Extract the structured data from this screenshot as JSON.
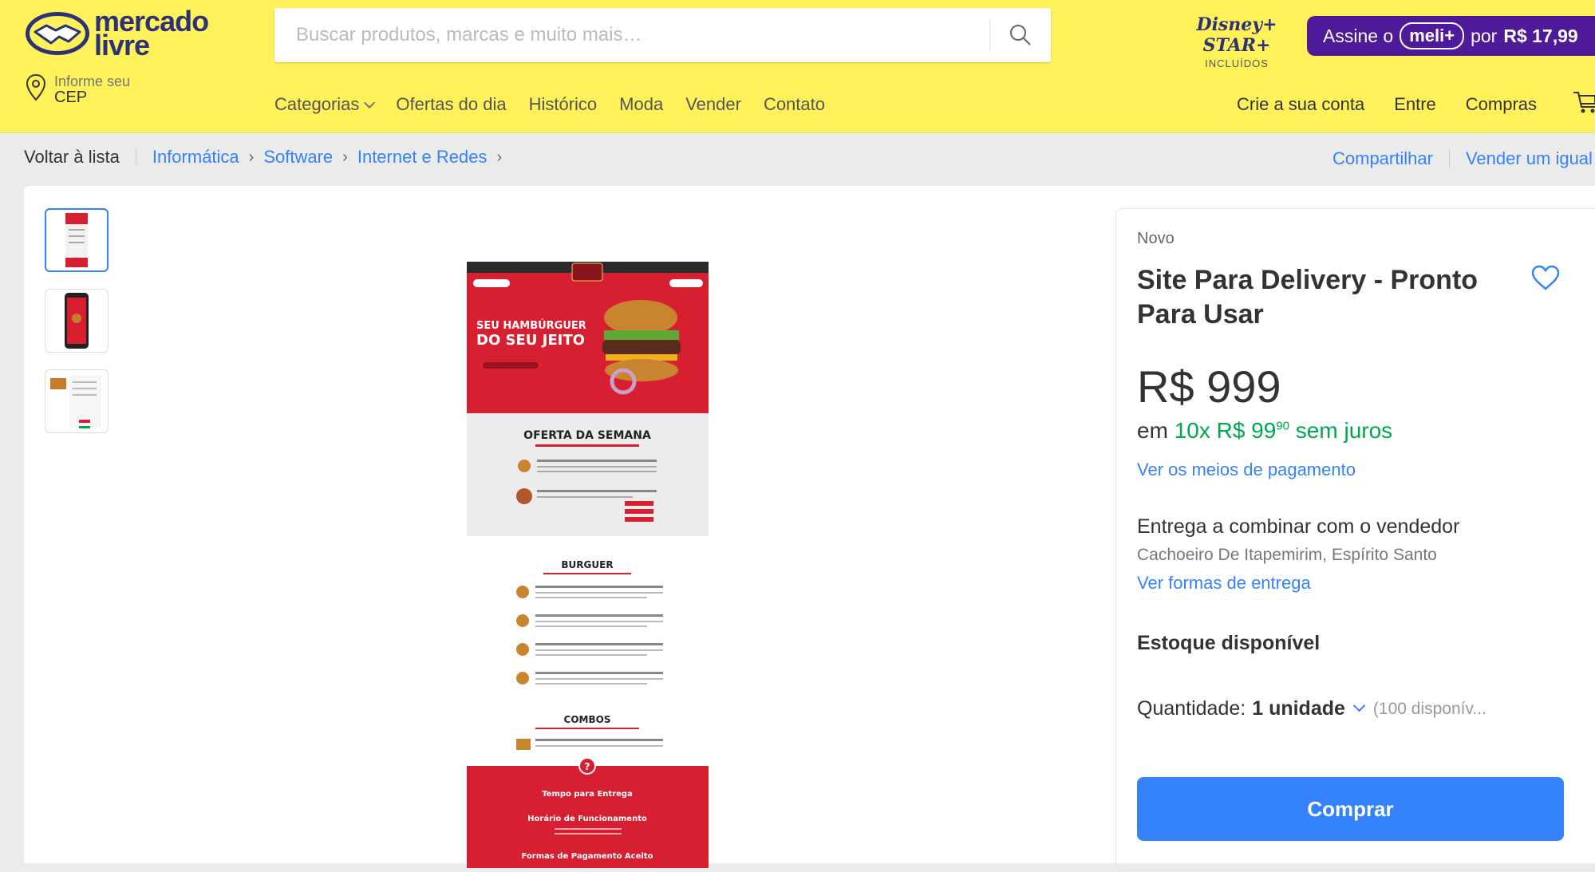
{
  "header": {
    "logo_text_line1": "mercado",
    "logo_text_line2": "livre",
    "search_placeholder": "Buscar produtos, marcas e muito mais…",
    "cep_line1": "Informe seu",
    "cep_line2": "CEP",
    "disney_line1": "Disney+ STAR+",
    "disney_line2": "INCLUÍDOS",
    "promo_prefix": "Assine o",
    "promo_brand": "meli+",
    "promo_mid": "por",
    "promo_price": "R$ 17,99",
    "nav": [
      "Categorias",
      "Ofertas do dia",
      "Histórico",
      "Moda",
      "Vender",
      "Contato"
    ],
    "account_nav": [
      "Crie a sua conta",
      "Entre",
      "Compras"
    ],
    "brand_color": "#fff159"
  },
  "breadcrumb": {
    "back": "Voltar à lista",
    "items": [
      "Informática",
      "Software",
      "Internet e Redes"
    ],
    "share": "Compartilhar",
    "sell": "Vender um igual"
  },
  "gallery": {
    "selected_index": 0,
    "main_image": {
      "hero_line1": "SEU HAMBÚRGUER",
      "hero_line2": "DO SEU JEITO",
      "section_offer": "OFERTA DA SEMANA",
      "section_burger": "BURGUER",
      "section_combos": "COMBOS",
      "footer_1": "Tempo para Entrega",
      "footer_2": "Horário de Funcionamento",
      "footer_3": "Formas de Pagamento Aceito"
    }
  },
  "product": {
    "condition": "Novo",
    "title": "Site Para Delivery - Pronto Para Usar",
    "price": "R$ 999",
    "installments_prefix": "em",
    "installments_main": "10x R$ 99",
    "installments_cents": "90",
    "installments_suffix": "sem juros",
    "payment_link": "Ver os meios de pagamento",
    "delivery": "Entrega a combinar com o vendedor",
    "location": "Cachoeiro De Itapemirim, Espírito Santo",
    "delivery_link": "Ver formas de entrega",
    "stock": "Estoque disponível",
    "quantity_label": "Quantidade:",
    "quantity_value": "1 unidade",
    "quantity_available": "(100 disponív...",
    "buy_button": "Comprar",
    "accent_color": "#3483fa",
    "green_color": "#00a650"
  }
}
